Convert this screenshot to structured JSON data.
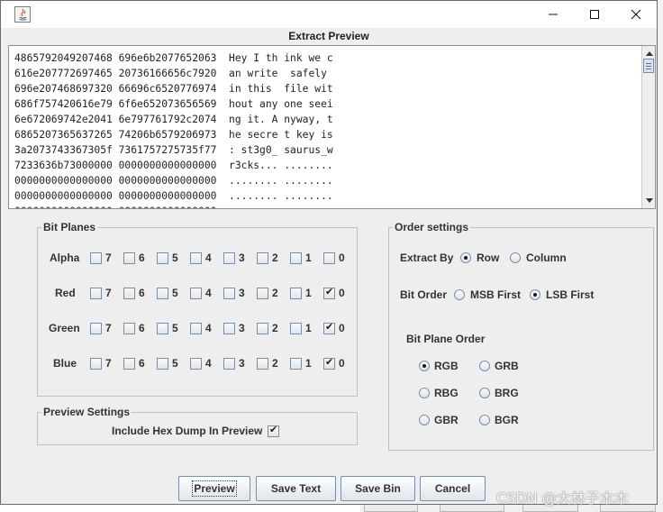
{
  "window": {
    "dialog_title": "Extract Preview"
  },
  "preview": {
    "lines": [
      "4865792049207468 696e6b2077652063  Hey I th ink we c",
      "616e207772697465 20736166656c7920  an write  safely ",
      "696e207468697320 66696c6520776974  in this  file wit",
      "686f757420616e79 6f6e652073656569  hout any one seei",
      "6e672069742e2041 6e797761792c2074  ng it. A nyway, t",
      "6865207365637265 74206b6579206973  he secre t key is",
      "3a2073743367305f 7361757275735f77  : st3g0_ saurus_w",
      "7233636b73000000 0000000000000000  r3cks... ........",
      "0000000000000000 0000000000000000  ........ ........",
      "0000000000000000 0000000000000000  ........ ........",
      "0000000000000000 0000000000000000  ........ ........"
    ]
  },
  "bit_planes": {
    "title": "Bit Planes",
    "bits": [
      "7",
      "6",
      "5",
      "4",
      "3",
      "2",
      "1",
      "0"
    ],
    "rows": [
      {
        "label": "Alpha",
        "checked": [
          false,
          false,
          false,
          false,
          false,
          false,
          false,
          false
        ]
      },
      {
        "label": "Red",
        "checked": [
          false,
          false,
          false,
          false,
          false,
          false,
          false,
          true
        ]
      },
      {
        "label": "Green",
        "checked": [
          false,
          false,
          false,
          false,
          false,
          false,
          false,
          true
        ]
      },
      {
        "label": "Blue",
        "checked": [
          false,
          false,
          false,
          false,
          false,
          false,
          false,
          true
        ]
      }
    ]
  },
  "preview_settings": {
    "title": "Preview Settings",
    "hex_dump_label": "Include Hex Dump In Preview",
    "hex_dump_checked": true
  },
  "order_settings": {
    "title": "Order settings",
    "extract_by_label": "Extract By",
    "extract_by_options": [
      "Row",
      "Column"
    ],
    "extract_by_selected": "Row",
    "bit_order_label": "Bit Order",
    "bit_order_options": [
      "MSB First",
      "LSB First"
    ],
    "bit_order_selected": "LSB First",
    "bit_plane_order_label": "Bit Plane Order",
    "bit_plane_order_options": [
      "RGB",
      "GRB",
      "RBG",
      "BRG",
      "GBR",
      "BGR"
    ],
    "bit_plane_order_selected": "RGB"
  },
  "buttons": {
    "preview": "Preview",
    "save_text": "Save Text",
    "save_bin": "Save Bin",
    "cancel": "Cancel"
  },
  "watermark": "CSDN @大林子木木",
  "colors": {
    "window_bg": "#eeeeee",
    "border": "#7a8ea8"
  }
}
